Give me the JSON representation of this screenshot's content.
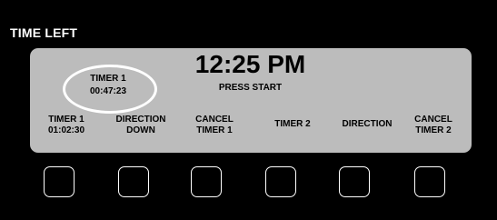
{
  "callout": {
    "label": "TIME LEFT"
  },
  "display": {
    "clock": "12:25 PM",
    "status": "PRESS START",
    "active_timer": {
      "name": "TIMER 1",
      "remaining": "00:47:23"
    }
  },
  "softkeys": [
    {
      "line1": "TIMER 1",
      "line2": "01:02:30"
    },
    {
      "line1": "DIRECTION",
      "line2": "DOWN"
    },
    {
      "line1": "CANCEL",
      "line2": "TIMER 1"
    },
    {
      "line1": "",
      "line2": "TIMER 2"
    },
    {
      "line1": "",
      "line2": "DIRECTION"
    },
    {
      "line1": "CANCEL",
      "line2": "TIMER 2"
    }
  ],
  "colors": {
    "background": "#000000",
    "lcd": "#bcbcbc",
    "highlight": "#ffffff"
  }
}
